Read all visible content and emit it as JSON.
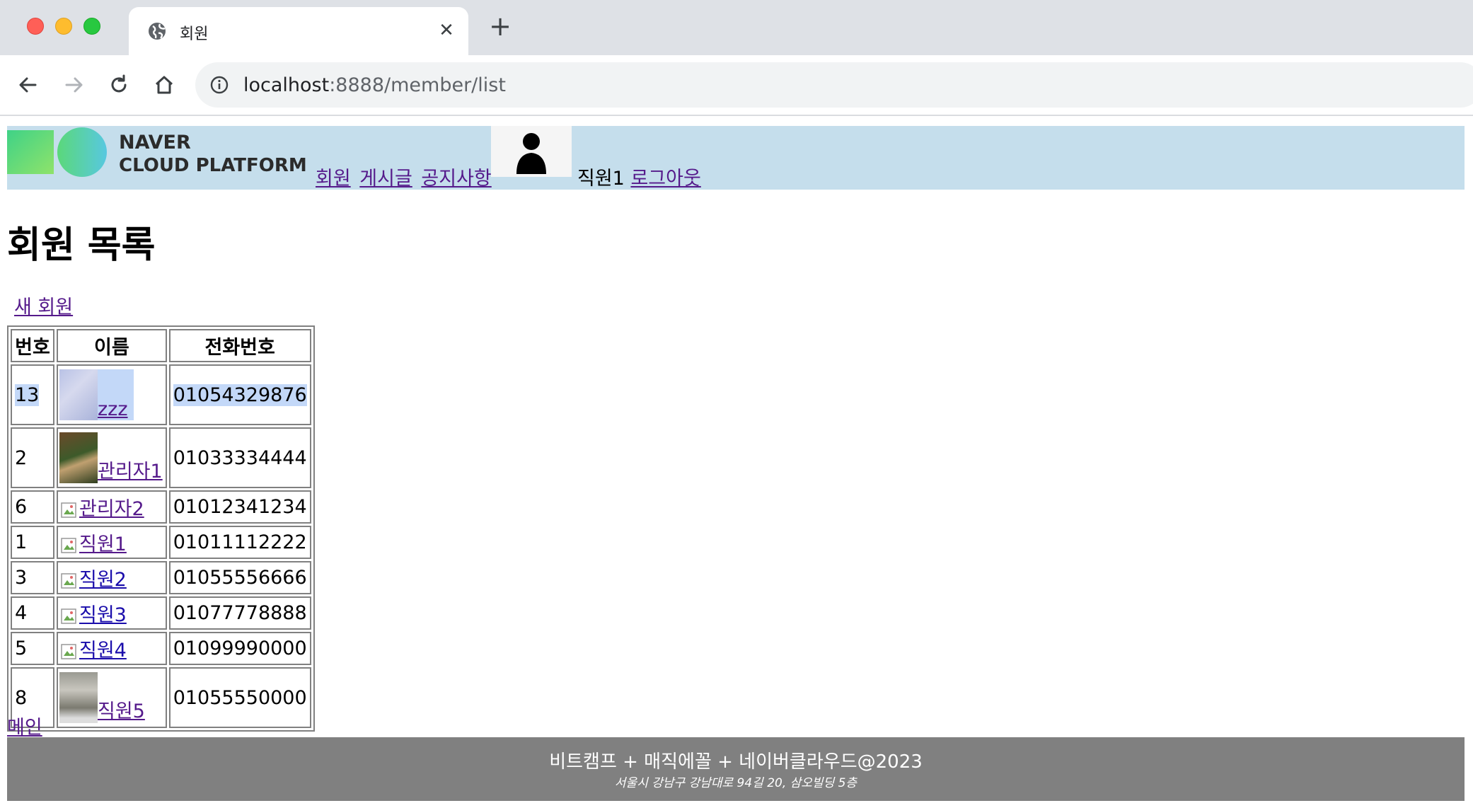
{
  "browser": {
    "tab_title": "회원",
    "url_host": "localhost",
    "url_path": ":8888/member/list"
  },
  "header": {
    "logo_line1": "NAVER",
    "logo_line2": "CLOUD PLATFORM",
    "nav": [
      "회원",
      "게시글",
      "공지사항"
    ],
    "user_name": "직원1",
    "logout_label": "로그아웃"
  },
  "main": {
    "title": "회원 목록",
    "new_member_label": "새 회원",
    "table_headers": [
      "번호",
      "이름",
      "전화번호"
    ],
    "rows": [
      {
        "no": "13",
        "name": "zzz",
        "phone": "01054329876"
      },
      {
        "no": "2",
        "name": "관리자1",
        "phone": "01033334444"
      },
      {
        "no": "6",
        "name": "관리자2",
        "phone": "01012341234"
      },
      {
        "no": "1",
        "name": "직원1",
        "phone": "01011112222"
      },
      {
        "no": "3",
        "name": "직원2",
        "phone": "01055556666"
      },
      {
        "no": "4",
        "name": "직원3",
        "phone": "01077778888"
      },
      {
        "no": "5",
        "name": "직원4",
        "phone": "01099990000"
      },
      {
        "no": "8",
        "name": "직원5",
        "phone": "01055550000"
      }
    ],
    "main_link_label": "메인"
  },
  "footer": {
    "line1": "비트캠프 + 매직에꼴 + 네이버클라우드@2023",
    "line2": "서울시 강남구 강남대로 94길 20, 삼오빌딩 5층"
  },
  "colors": {
    "header_bg": "#c5deec",
    "footer_bg": "#808080",
    "selection": "#c3d8f8"
  }
}
